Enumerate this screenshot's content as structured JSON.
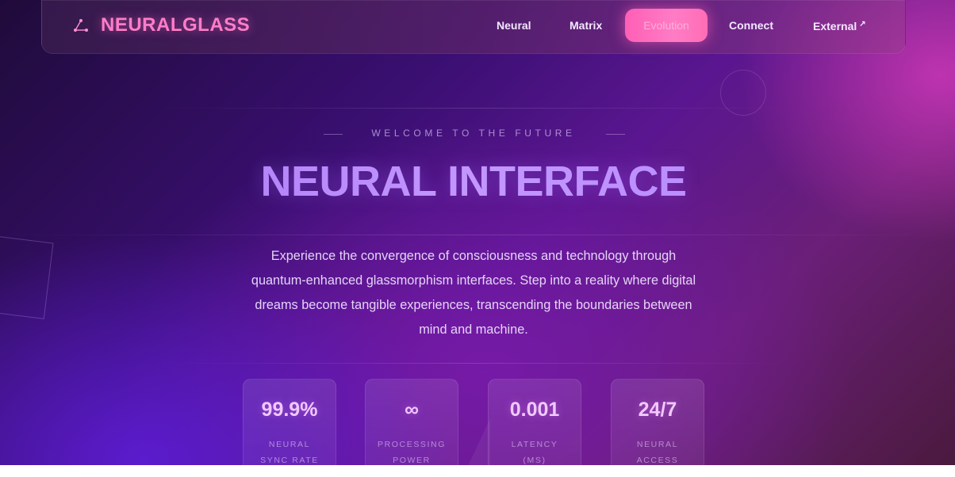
{
  "brand": {
    "name": "NEURALGLASS",
    "icon": "neural-triangle-icon"
  },
  "nav": {
    "items": [
      {
        "label": "Neural"
      },
      {
        "label": "Matrix"
      },
      {
        "label": "Evolution"
      },
      {
        "label": "Connect"
      },
      {
        "label": "External",
        "icon": "external-arrow-icon",
        "icon_glyph": "↗"
      }
    ]
  },
  "hero": {
    "eyebrow": "WELCOME TO THE FUTURE",
    "title": "NEURAL INTERFACE",
    "description_lines": [
      "Experience the convergence of consciousness and technology through",
      "quantum-enhanced glassmorphism interfaces. Step into a reality where digital",
      "dreams become tangible experiences, transcending the boundaries between",
      "mind and machine."
    ]
  },
  "stats": [
    {
      "value": "99.9%",
      "label_lines": [
        "NEURAL",
        "SYNC RATE"
      ]
    },
    {
      "value": "∞",
      "label_lines": [
        "PROCESSING",
        "POWER"
      ]
    },
    {
      "value": "0.001",
      "label_lines": [
        "LATENCY",
        "(MS)"
      ]
    },
    {
      "value": "24/7",
      "label_lines": [
        "NEURAL",
        "ACCESS"
      ]
    }
  ],
  "colors": {
    "brand": "#ff7dc8",
    "accent_pill": "#ff6db6",
    "hero_title": "#b58aff",
    "stat_value": "#f0c8ff"
  }
}
